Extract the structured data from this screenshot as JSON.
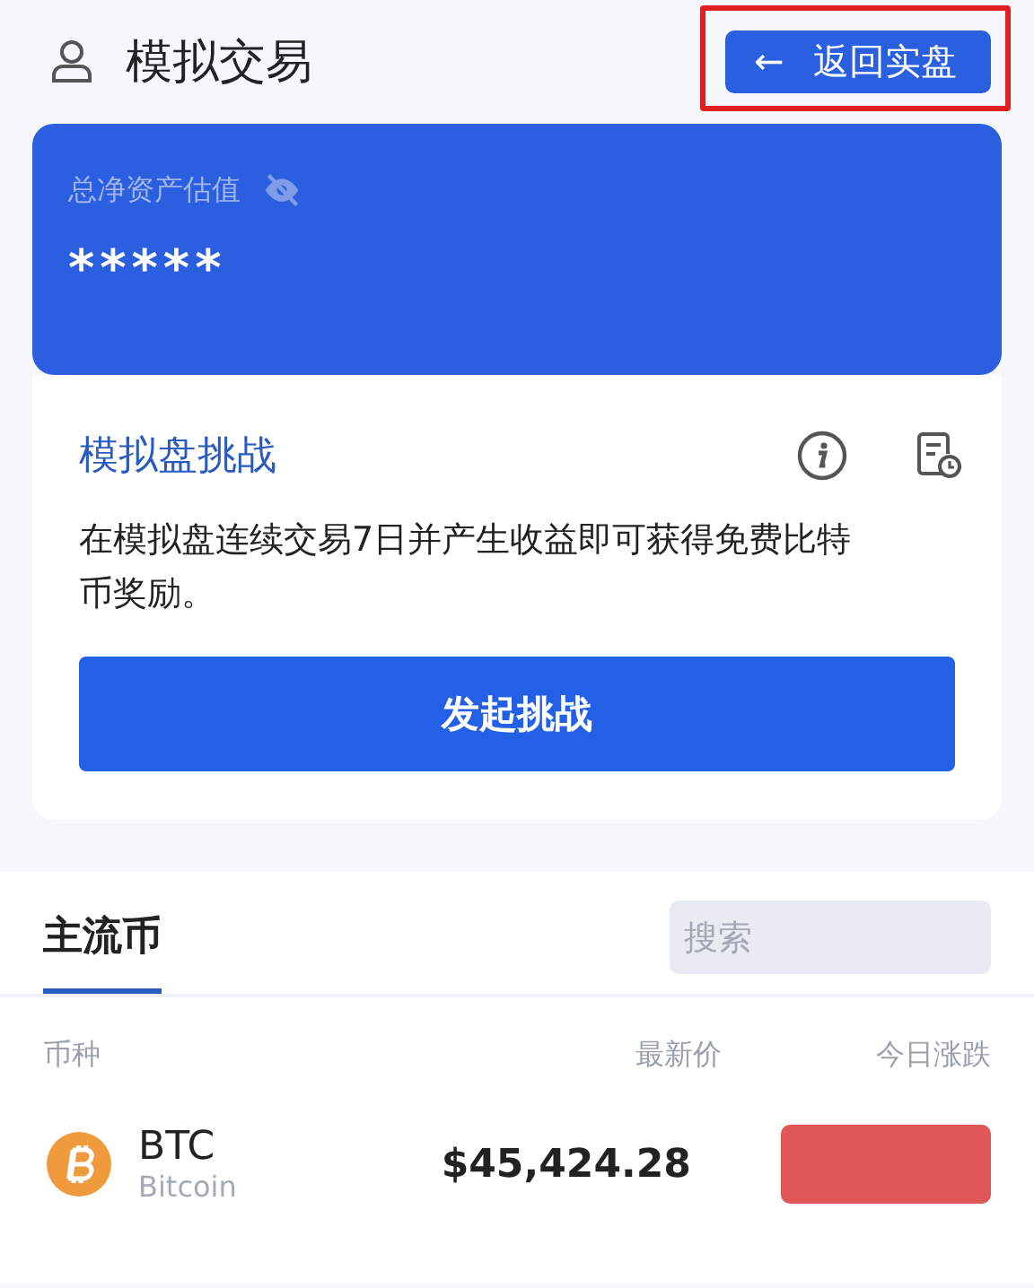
{
  "header": {
    "title": "模拟交易",
    "back_button": "返回实盘",
    "back_icon": "←",
    "highlighted": true
  },
  "asset_card": {
    "label": "总净资产估值",
    "value": "*****",
    "hidden": true
  },
  "challenge": {
    "title": "模拟盘挑战",
    "description": "在模拟盘连续交易7日并产生收益即可获得免费比特币奖励。",
    "button": "发起挑战"
  },
  "market": {
    "tabs": [
      {
        "label": "主流币",
        "selected": true
      }
    ],
    "search": {
      "placeholder": "搜索"
    },
    "columns": [
      "币种",
      "最新价",
      "今日涨跌"
    ],
    "rows": [
      {
        "symbol": "BTC",
        "name": "Bitcoin",
        "price": "$45,424.28",
        "color": "#e05757"
      }
    ]
  }
}
